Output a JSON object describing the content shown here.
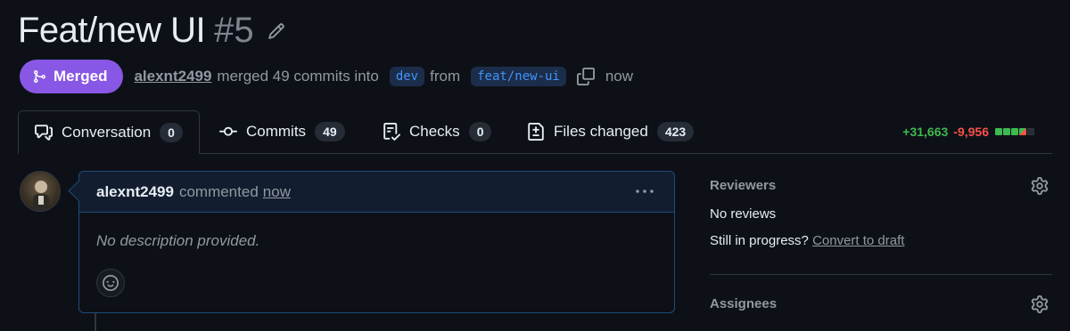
{
  "header": {
    "title": "Feat/new UI",
    "number": "#5"
  },
  "meta": {
    "state_label": "Merged",
    "author": "alexnt2499",
    "merged_text": "merged 49 commits into",
    "base_branch": "dev",
    "from_text": "from",
    "head_branch": "feat/new-ui",
    "time": "now"
  },
  "tabs": [
    {
      "label": "Conversation",
      "count": "0",
      "icon": "comment-discussion-icon"
    },
    {
      "label": "Commits",
      "count": "49",
      "icon": "commit-icon"
    },
    {
      "label": "Checks",
      "count": "0",
      "icon": "checklist-icon"
    },
    {
      "label": "Files changed",
      "count": "423",
      "icon": "file-diff-icon"
    }
  ],
  "diffstat": {
    "additions": "+31,663",
    "deletions": "-9,956"
  },
  "comment": {
    "author": "alexnt2499",
    "action": "commented",
    "time": "now",
    "body": "No description provided."
  },
  "sidebar": {
    "reviewers_heading": "Reviewers",
    "reviewers_value": "No reviews",
    "progress_text": "Still in progress?",
    "convert_link": "Convert to draft",
    "assignees_heading": "Assignees"
  },
  "colors": {
    "merged": "#8957e5",
    "additions": "#3fb950",
    "deletions": "#f85149",
    "accent_link": "#4493f8"
  }
}
